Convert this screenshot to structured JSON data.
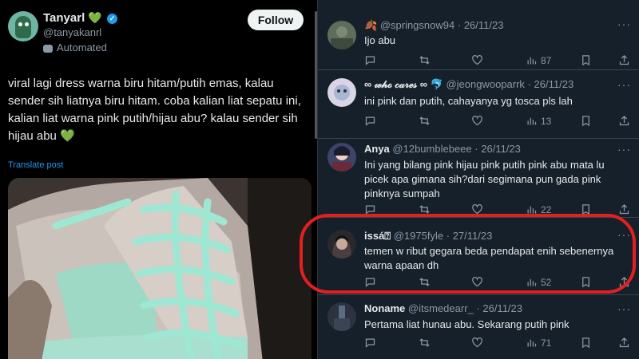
{
  "post": {
    "author_name": "Tanyarl",
    "author_emoji": "💚",
    "author_handle": "@tanyakanrl",
    "automated_label": "Automated",
    "follow_label": "Follow",
    "text": "viral lagi dress warna biru hitam/putih emas, kalau sender sih liatnya biru hitam. coba kalian liat sepatu ini, kalian liat warna pink putih/hijau abu? kalau sender sih hijau abu 💚",
    "translate_label": "Translate post"
  },
  "replies": [
    {
      "name": "",
      "name_prefix": "🍂",
      "handle": "@springsnow94",
      "date": "26/11/23",
      "text": "Ijo abu",
      "views": "87",
      "avatar_color": "#6c7a6a"
    },
    {
      "name": "∞ 𝓌𝒽ℴ 𝒸𝒶𝓇ℯ𝓈 ∞ 🐬",
      "name_prefix": "",
      "handle": "@jeongwooparrk",
      "date": "26/11/23",
      "text": "ini pink dan putih, cahayanya yg tosca pls lah",
      "views": "13",
      "avatar_color": "#c9c7d8"
    },
    {
      "name": "Anya",
      "name_prefix": "",
      "handle": "@12bumblebeee",
      "date": "26/11/23",
      "text": "Ini yang bilang pink hijau pink putih pink abu mata lu picek apa gimana sih?dari segimana pun gada pink pinknya sumpah",
      "views": "22",
      "avatar_color": "#4a4e6a"
    },
    {
      "name": "issá⍰",
      "name_prefix": "",
      "handle": "@1975fyle",
      "date": "27/11/23",
      "text": "temen w ribut gegara beda pendapat enih sebenernya warna apaan dh",
      "views": "52",
      "avatar_color": "#2c2a30"
    },
    {
      "name": "Noname",
      "name_prefix": "",
      "handle": "@itsmedearr_",
      "date": "26/11/23",
      "text": "Pertama liat hunau abu. Sekarang putih pink",
      "views": "71",
      "avatar_color": "#333844"
    }
  ],
  "colors": {
    "accent": "#1d9bf0",
    "highlight": "#e41f1f",
    "reply_bg": "#15202b"
  }
}
